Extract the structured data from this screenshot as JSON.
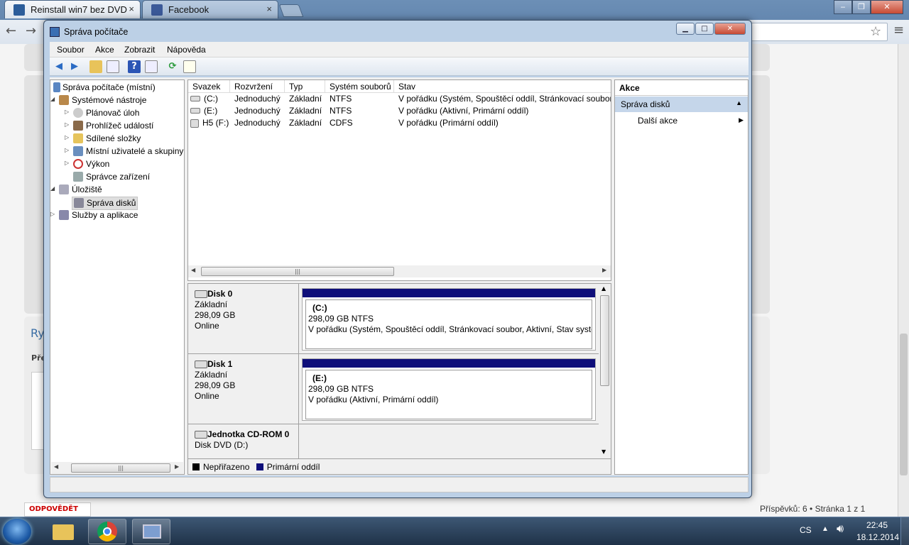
{
  "browser": {
    "tabs": [
      {
        "title": "Reinstall win7 bez DVD",
        "active": true
      },
      {
        "title": "Facebook",
        "active": false
      }
    ],
    "close_glyph": "×",
    "window_buttons": {
      "minimize": "‒",
      "maximize": "❐",
      "close": "✕"
    },
    "nav": {
      "back": "←",
      "forward": "→",
      "star": "☆",
      "menu": "≡"
    }
  },
  "webpage": {
    "sidebar_heading": "Ry",
    "sidebar_label": "Pře",
    "reply_button": "ODPOVĚDĚT",
    "pager": "Příspěvků: 6 • Stránka 1 z 1"
  },
  "mmc": {
    "title": "Správa počítače",
    "caption_buttons": {
      "minimize": "▁",
      "maximize": "□",
      "close": "✕"
    },
    "menu": [
      "Soubor",
      "Akce",
      "Zobrazit",
      "Nápověda"
    ],
    "tree": {
      "root": "Správa počítače (místní)",
      "items": [
        "Systémové nástroje",
        "Plánovač úloh",
        "Prohlížeč událostí",
        "Sdílené složky",
        "Místní uživatelé a skupiny",
        "Výkon",
        "Správce zařízení",
        "Úložiště",
        "Správa disků",
        "Služby a aplikace"
      ]
    },
    "volumes": {
      "columns": [
        "Svazek",
        "Rozvržení",
        "Typ",
        "Systém souborů",
        "Stav"
      ],
      "rows": [
        [
          "(C:)",
          "Jednoduchý",
          "Základní",
          "NTFS",
          "V pořádku (Systém, Spouštěcí oddíl, Stránkovací soubor,"
        ],
        [
          "(E:)",
          "Jednoduchý",
          "Základní",
          "NTFS",
          "V pořádku (Aktivní, Primární oddíl)"
        ],
        [
          "H5 (F:)",
          "Jednoduchý",
          "Základní",
          "CDFS",
          "V pořádku (Primární oddíl)"
        ]
      ]
    },
    "disks": [
      {
        "name": "Disk 0",
        "type": "Základní",
        "size": "298,09 GB",
        "status": "Online",
        "partition": {
          "label": "(C:)",
          "size_fs": "298,09 GB NTFS",
          "status": "V pořádku (Systém, Spouštěcí oddíl, Stránkovací soubor, Aktivní, Stav systém"
        }
      },
      {
        "name": "Disk 1",
        "type": "Základní",
        "size": "298,09 GB",
        "status": "Online",
        "partition": {
          "label": "(E:)",
          "size_fs": "298,09 GB NTFS",
          "status": "V pořádku (Aktivní, Primární oddíl)"
        }
      },
      {
        "name": "Jednotka CD-ROM 0",
        "type": "Disk DVD (D:)"
      }
    ],
    "legend": [
      "Nepřiřazeno",
      "Primární oddíl"
    ],
    "actions": {
      "header": "Akce",
      "section": "Správa disků",
      "item": "Další akce"
    }
  },
  "taskbar": {
    "language": "CS",
    "time": "22:45",
    "date": "18.12.2014"
  },
  "colors": {
    "primary_partition": "#0e0e7a",
    "unallocated": "#000000",
    "actions_section": "#c5d6ea"
  }
}
